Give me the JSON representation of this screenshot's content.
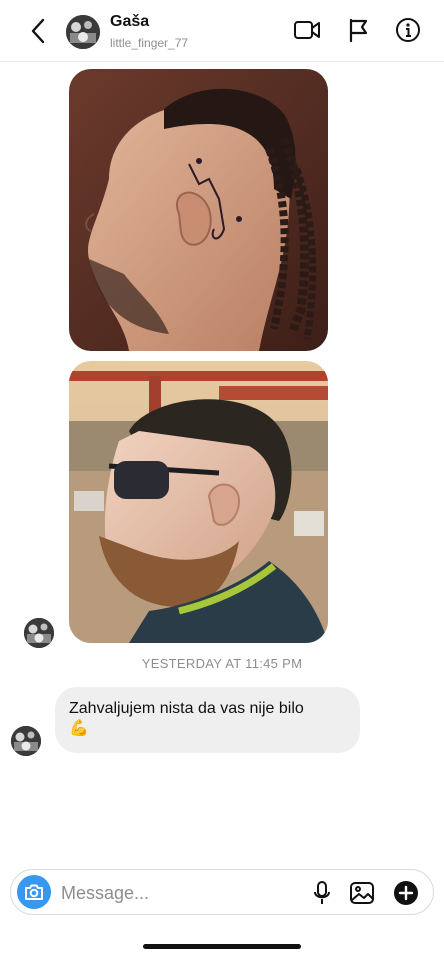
{
  "header": {
    "contact_name": "Gaša",
    "contact_handle": "little_finger_77",
    "icons": [
      "chevron-left-icon",
      "video-camera-icon",
      "flag-icon",
      "info-icon"
    ]
  },
  "thread": {
    "timestamp": "YESTERDAY AT 11:45 PM",
    "message_text": "Zahvaljujem nista da vas nije bilo",
    "message_emoji": "💪"
  },
  "composer": {
    "placeholder": "Message...",
    "icons": [
      "camera-icon",
      "microphone-icon",
      "image-icon",
      "plus-icon"
    ]
  },
  "colors": {
    "accent_blue": "#3897f0",
    "bubble_gray": "#efefef",
    "meta_gray": "#8e8e8e"
  }
}
